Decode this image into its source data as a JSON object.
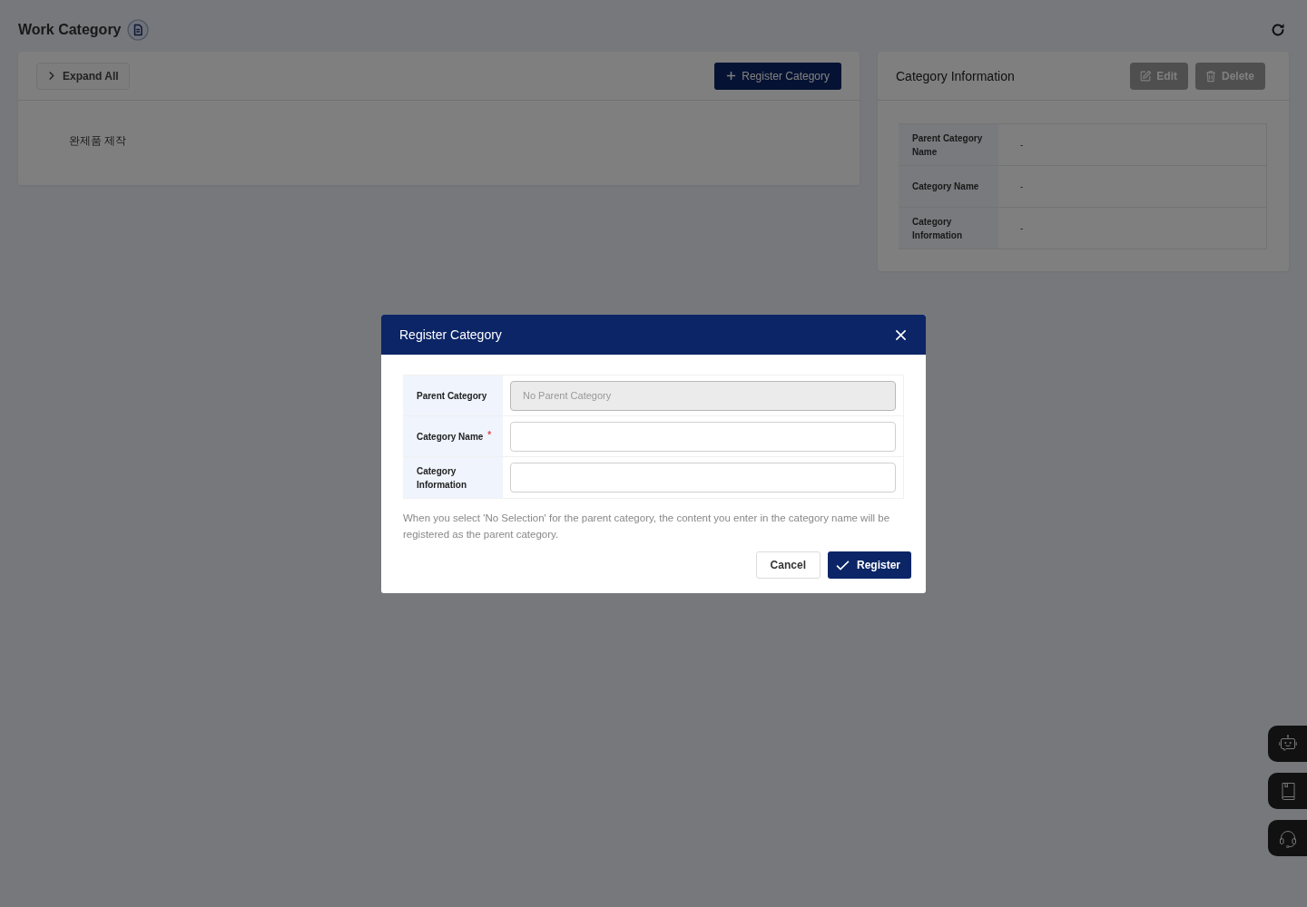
{
  "page": {
    "title": "Work Category"
  },
  "tree_panel": {
    "expand_button": "Expand All",
    "register_button": "Register Category",
    "items": [
      {
        "label": "완제품 제작"
      }
    ]
  },
  "info_panel": {
    "title": "Category Information",
    "buttons": [
      {
        "label": "Edit",
        "kind": "edit",
        "disabled": true
      },
      {
        "label": "Delete",
        "kind": "delete",
        "disabled": true
      }
    ],
    "rows": [
      {
        "label": "Parent Category Name",
        "value": "-"
      },
      {
        "label": "Category Name",
        "value": "-"
      },
      {
        "label": "Category Information",
        "value": "-"
      }
    ]
  },
  "dialog": {
    "title": "Register Category",
    "fields": [
      {
        "label": "Parent Category",
        "placeholder": "No Parent Category",
        "disabled": true
      },
      {
        "label": "Category Name",
        "label_mark": "*",
        "disabled": false
      },
      {
        "label": "Category Information",
        "disabled": false
      }
    ],
    "note": "When you select 'No Selection' for the parent category, the content you enter in the category name will be registered as the parent category.",
    "buttons": [
      {
        "label": "Cancel",
        "kind": "cancel"
      },
      {
        "label": "Register",
        "kind": "confirm"
      }
    ]
  },
  "side_dock": [
    {
      "kind": "bot"
    },
    {
      "kind": "book"
    },
    {
      "kind": "headset"
    }
  ]
}
